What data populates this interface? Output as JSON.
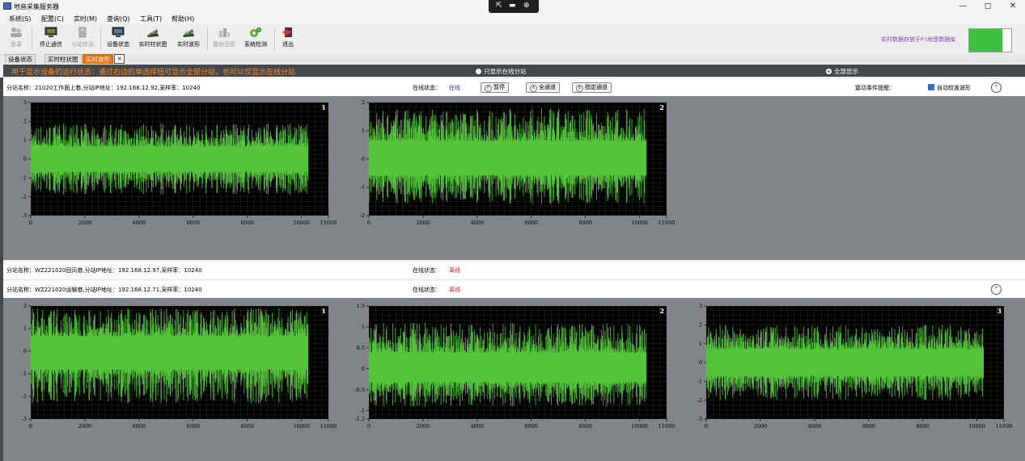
{
  "window": {
    "title": "地音采集服务器",
    "controls": {
      "minimize": "—",
      "restore": "◻",
      "close": "✕"
    },
    "remote_bar": {
      "icons": [
        "pin-icon",
        "monitor-icon",
        "close-circle-icon"
      ],
      "glyphs": [
        "⇱",
        "▬",
        "⊗"
      ]
    }
  },
  "menu": [
    "系统(S)",
    "配置(C)",
    "实时(M)",
    "查询(Q)",
    "工具(T)",
    "帮助(H)"
  ],
  "toolbar": {
    "buttons": [
      {
        "label": "登录",
        "enabled": false,
        "icon": "users-icon"
      },
      {
        "label": "停止通信",
        "enabled": true,
        "icon": "monitor-icon"
      },
      {
        "label": "分站信息",
        "enabled": false,
        "icon": "device-icon"
      },
      {
        "label": "设备状态",
        "enabled": true,
        "icon": "monitor-icon"
      },
      {
        "label": "实时柱状图",
        "enabled": true,
        "icon": "chart-icon"
      },
      {
        "label": "实时波形",
        "enabled": true,
        "icon": "chart-icon"
      },
      {
        "label": "备份还原",
        "enabled": false,
        "icon": "backup-icon"
      },
      {
        "label": "系统检测",
        "enabled": true,
        "icon": "gear-icon"
      },
      {
        "label": "退出",
        "enabled": true,
        "icon": "exit-icon"
      }
    ],
    "storage_text": "实时数据存放于F:\\地音数据库",
    "storage_fraction": 0.79
  },
  "tabs": [
    {
      "label": "设备状态",
      "active": false
    },
    {
      "label": "实时柱状图",
      "active": false
    },
    {
      "label": "实时波形",
      "active": true
    }
  ],
  "tab_close": "✕",
  "infobar": {
    "hint": "用于显示设备的运行状态：通过右边的单选择钮可显示全部分站，也可以仅显示在线分站",
    "radio_online_only": "只显示在线分站",
    "radio_all": "全部显示",
    "selected": "all"
  },
  "stations": [
    {
      "info": "分站名称：21020工作面上巷,分站IP地址：192.168.12.92,采样率：10240",
      "status_label": "在线状态：",
      "status": "在线",
      "pause_label": "暂停",
      "all_channels_label": "全通道",
      "specified_channels_label": "指定通道",
      "event_label": "震动事件提醒：",
      "auto_calibrate_label": "自动校准波形",
      "collapse_glyph": "⌃"
    },
    {
      "info": "分站名称：WZ221020回风巷,分站IP地址：192.168.12.97,采样率：10240",
      "status_label": "在线状态：",
      "status": "离线"
    },
    {
      "info": "分站名称：WZ221020运输巷,分站IP地址：192.168.12.71,采样率：10240",
      "status_label": "在线状态：",
      "status": "离线",
      "collapse_glyph": "⌃"
    }
  ],
  "colors": {
    "waveform": "#54c43a",
    "plot_bg": "#000000",
    "grid": "#8a8a5a",
    "panel_bg": "#818488",
    "accent": "#e8720c"
  },
  "chart_data": [
    {
      "type": "line",
      "station": 1,
      "channel": "1",
      "title": "1",
      "xlim": [
        0,
        11000
      ],
      "ylim": [
        -3,
        3
      ],
      "xticks": [
        0,
        2000,
        4000,
        6000,
        8000,
        10000,
        11000
      ],
      "yticks": [
        -3,
        -2,
        -1,
        0,
        1,
        2,
        3
      ],
      "signal_end": 10240,
      "envelope": [
        -1.9,
        1.9
      ],
      "grid": true
    },
    {
      "type": "line",
      "station": 1,
      "channel": "2",
      "title": "2",
      "xlim": [
        0,
        11000
      ],
      "ylim": [
        -2,
        2
      ],
      "xticks": [
        0,
        2000,
        4000,
        6000,
        8000,
        10000,
        11000
      ],
      "yticks": [
        -2,
        -1,
        0,
        1,
        2
      ],
      "signal_end": 10240,
      "envelope": [
        -1.6,
        1.8
      ],
      "grid": true
    },
    {
      "type": "line",
      "station": 3,
      "channel": "1",
      "title": "1",
      "xlim": [
        0,
        11000
      ],
      "ylim": [
        -3,
        2
      ],
      "xticks": [
        0,
        2000,
        4000,
        6000,
        8000,
        10000,
        11000
      ],
      "yticks": [
        -3,
        -2,
        -1,
        0,
        1,
        2
      ],
      "signal_end": 10240,
      "envelope": [
        -2.3,
        1.9
      ],
      "grid": true
    },
    {
      "type": "line",
      "station": 3,
      "channel": "2",
      "title": "2",
      "xlim": [
        0,
        11000
      ],
      "ylim": [
        -1.2,
        1.5
      ],
      "xticks": [
        0,
        2000,
        4000,
        6000,
        8000,
        10000,
        11000
      ],
      "yticks": [
        -1.2,
        -1,
        -0.5,
        0,
        0.5,
        1,
        1.5
      ],
      "signal_end": 10240,
      "envelope": [
        -0.9,
        1.1
      ],
      "grid": true
    },
    {
      "type": "line",
      "station": 3,
      "channel": "3",
      "title": "3",
      "xlim": [
        0,
        11000
      ],
      "ylim": [
        -3,
        3
      ],
      "xticks": [
        0,
        2000,
        4000,
        6000,
        8000,
        10000,
        11000
      ],
      "yticks": [
        -3,
        -2,
        -1,
        0,
        1,
        2,
        3
      ],
      "signal_end": 10240,
      "envelope": [
        -2.0,
        2.0
      ],
      "grid": true
    }
  ]
}
